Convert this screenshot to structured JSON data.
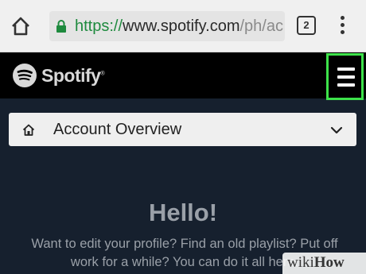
{
  "browser": {
    "url_scheme": "https://",
    "url_host": "www.spotify.com",
    "url_path": "/ph/ac",
    "tab_count": "2",
    "icons": {
      "home": "home-icon",
      "lock": "lock-icon",
      "menu": "more-vert-icon"
    }
  },
  "header": {
    "brand": "Spotify",
    "registered_mark": "®",
    "menu_icon": "hamburger-menu-icon",
    "highlight_color": "#3de24a"
  },
  "account_select": {
    "label": "Account Overview",
    "icon": "home-icon",
    "chevron": "chevron-down-icon"
  },
  "content": {
    "heading": "Hello!",
    "intro": "Want to edit your profile? Find an old playlist? Put off work for a while? You can do it all here."
  },
  "watermark": {
    "prefix": "wiki",
    "suffix": "How"
  },
  "colors": {
    "page_bg": "#16202e",
    "header_bg": "#000000",
    "text_muted": "#9aa0a8"
  }
}
